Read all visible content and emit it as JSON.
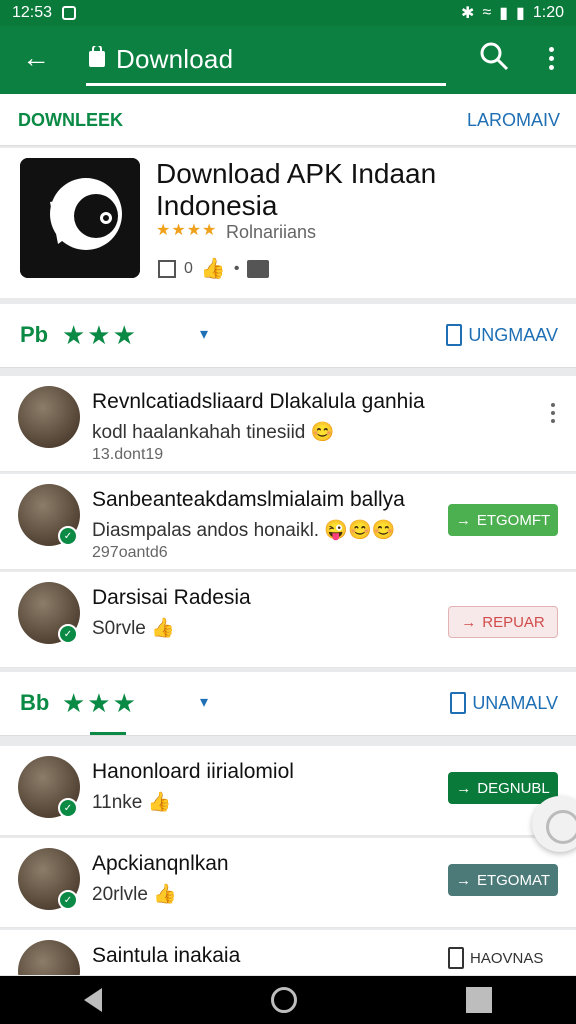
{
  "status": {
    "time_left": "12:53",
    "time_right": "1:20"
  },
  "appbar": {
    "title": "Download"
  },
  "tabs": {
    "left": "DOWNLEEK",
    "right": "LAROMAIV"
  },
  "app": {
    "name": "Download APK Indaan Indonesia",
    "stars": "★★★★",
    "rating_label": "Rolnariians",
    "meta_count": "0",
    "meta_dot": "•"
  },
  "sections": [
    {
      "label": "Pb",
      "stars": "★★★",
      "right_label": "UNGMAAV"
    },
    {
      "label": "Bb",
      "stars": "★★★",
      "right_label": "UNAMALV"
    }
  ],
  "rows": [
    {
      "title": "Revnlcatiadsliaard Dlakalula ganhia",
      "sub": "kodl haalankahah tinesiid 😊",
      "sub2": "13.dont19",
      "action": ""
    },
    {
      "title": "Sanbeanteakdamslmialaim ballya",
      "sub": "Diasmpalas andos honaikl. 😜😊😊",
      "sub2": "297oantd6",
      "action": "ETGOMFT"
    },
    {
      "title": "Darsisai Radesia",
      "sub": "S0rvle 👍",
      "sub2": "",
      "action": "REPUAR"
    },
    {
      "title": "Hanonloard iirialomiol",
      "sub": "11nke 👍",
      "sub2": "",
      "action": "DEGNUBL"
    },
    {
      "title": "Apckianqnlkan",
      "sub": "20rlvle 👍",
      "sub2": "",
      "action": "ETGOMAT"
    },
    {
      "title": "Saintula inakaia",
      "sub": "",
      "sub2": "",
      "action": "HAOVNAS"
    }
  ]
}
